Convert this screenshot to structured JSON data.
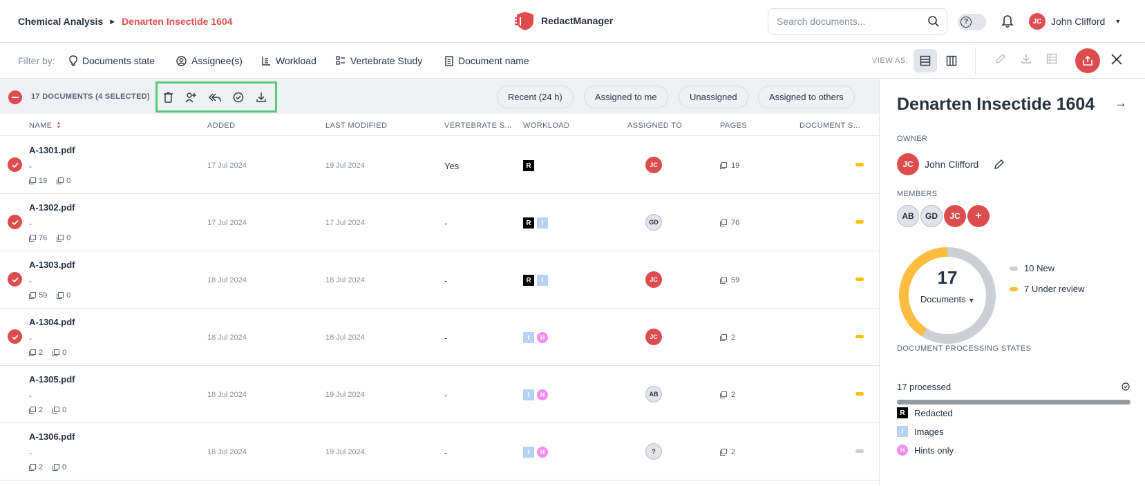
{
  "header": {
    "breadcrumb_root": "Chemical Analysis",
    "breadcrumb_current": "Denarten Insectide 1604",
    "brand": "RedactManager",
    "search_placeholder": "Search documents...",
    "user_initials": "JC",
    "user_name": "John Clifford"
  },
  "filters": {
    "label": "Filter by:",
    "items": [
      "Documents state",
      "Assignee(s)",
      "Workload",
      "Vertebrate Study",
      "Document name"
    ],
    "view_as": "VIEW AS:"
  },
  "list": {
    "count_label": "17 DOCUMENTS (4 SELECTED)",
    "quick_filters": [
      "Recent (24 h)",
      "Assigned to me",
      "Unassigned",
      "Assigned to others"
    ],
    "columns": [
      "NAME",
      "ADDED",
      "LAST MODIFIED",
      "VERTEBRATE S...",
      "WORKLOAD",
      "ASSIGNED TO",
      "PAGES",
      "DOCUMENT S..."
    ],
    "rows": [
      {
        "name": "A-1301.pdf",
        "sub": "-",
        "pages_stat": "19",
        "annot_stat": "0",
        "added": "17 Jul 2024",
        "modified": "19 Jul 2024",
        "vertebrate": "Yes",
        "workload": [
          "R"
        ],
        "assignee": "JC",
        "assignee_style": "red",
        "pages": "19",
        "status_color": "#fdbd00",
        "selected": true
      },
      {
        "name": "A-1302.pdf",
        "sub": "-",
        "pages_stat": "76",
        "annot_stat": "0",
        "added": "17 Jul 2024",
        "modified": "17 Jul 2024",
        "vertebrate": "-",
        "workload": [
          "R",
          "I"
        ],
        "assignee": "GD",
        "assignee_style": "grey",
        "pages": "76",
        "status_color": "#fdbd00",
        "selected": true
      },
      {
        "name": "A-1303.pdf",
        "sub": "-",
        "pages_stat": "59",
        "annot_stat": "0",
        "added": "18 Jul 2024",
        "modified": "18 Jul 2024",
        "vertebrate": "-",
        "workload": [
          "R",
          "I"
        ],
        "assignee": "JC",
        "assignee_style": "red",
        "pages": "59",
        "status_color": "#fdbd00",
        "selected": true
      },
      {
        "name": "A-1304.pdf",
        "sub": "-",
        "pages_stat": "2",
        "annot_stat": "0",
        "added": "18 Jul 2024",
        "modified": "18 Jul 2024",
        "vertebrate": "-",
        "workload": [
          "I",
          "H"
        ],
        "assignee": "JC",
        "assignee_style": "red",
        "pages": "2",
        "status_color": "#fdbd00",
        "selected": true
      },
      {
        "name": "A-1305.pdf",
        "sub": "-",
        "pages_stat": "2",
        "annot_stat": "0",
        "added": "18 Jul 2024",
        "modified": "19 Jul 2024",
        "vertebrate": "-",
        "workload": [
          "I",
          "H"
        ],
        "assignee": "AB",
        "assignee_style": "grey",
        "pages": "2",
        "status_color": "#fdbd00",
        "selected": false
      },
      {
        "name": "A-1306.pdf",
        "sub": "-",
        "pages_stat": "2",
        "annot_stat": "0",
        "added": "18 Jul 2024",
        "modified": "19 Jul 2024",
        "vertebrate": "-",
        "workload": [
          "I",
          "H"
        ],
        "assignee": "?",
        "assignee_style": "grey",
        "pages": "2",
        "status_color": "#c8cbd0",
        "selected": false
      }
    ]
  },
  "side": {
    "title": "Denarten Insectide 1604",
    "owner_label": "OWNER",
    "owner_initials": "JC",
    "owner_name": "John Clifford",
    "members_label": "MEMBERS",
    "members": [
      "AB",
      "GD",
      "JC",
      "+"
    ],
    "donut_total": "17",
    "donut_label": "Documents",
    "donut_segments": [
      {
        "label": "10 New",
        "value": 10,
        "color": "#cccfd4"
      },
      {
        "label": "7 Under review",
        "value": 7,
        "color": "#fdbd41"
      }
    ],
    "processing_label": "DOCUMENT PROCESSING STATES",
    "processed": "17 processed",
    "workload_legend": [
      {
        "key": "R",
        "label": "Redacted"
      },
      {
        "key": "I",
        "label": "Images"
      },
      {
        "key": "H",
        "label": "Hints only"
      }
    ]
  }
}
